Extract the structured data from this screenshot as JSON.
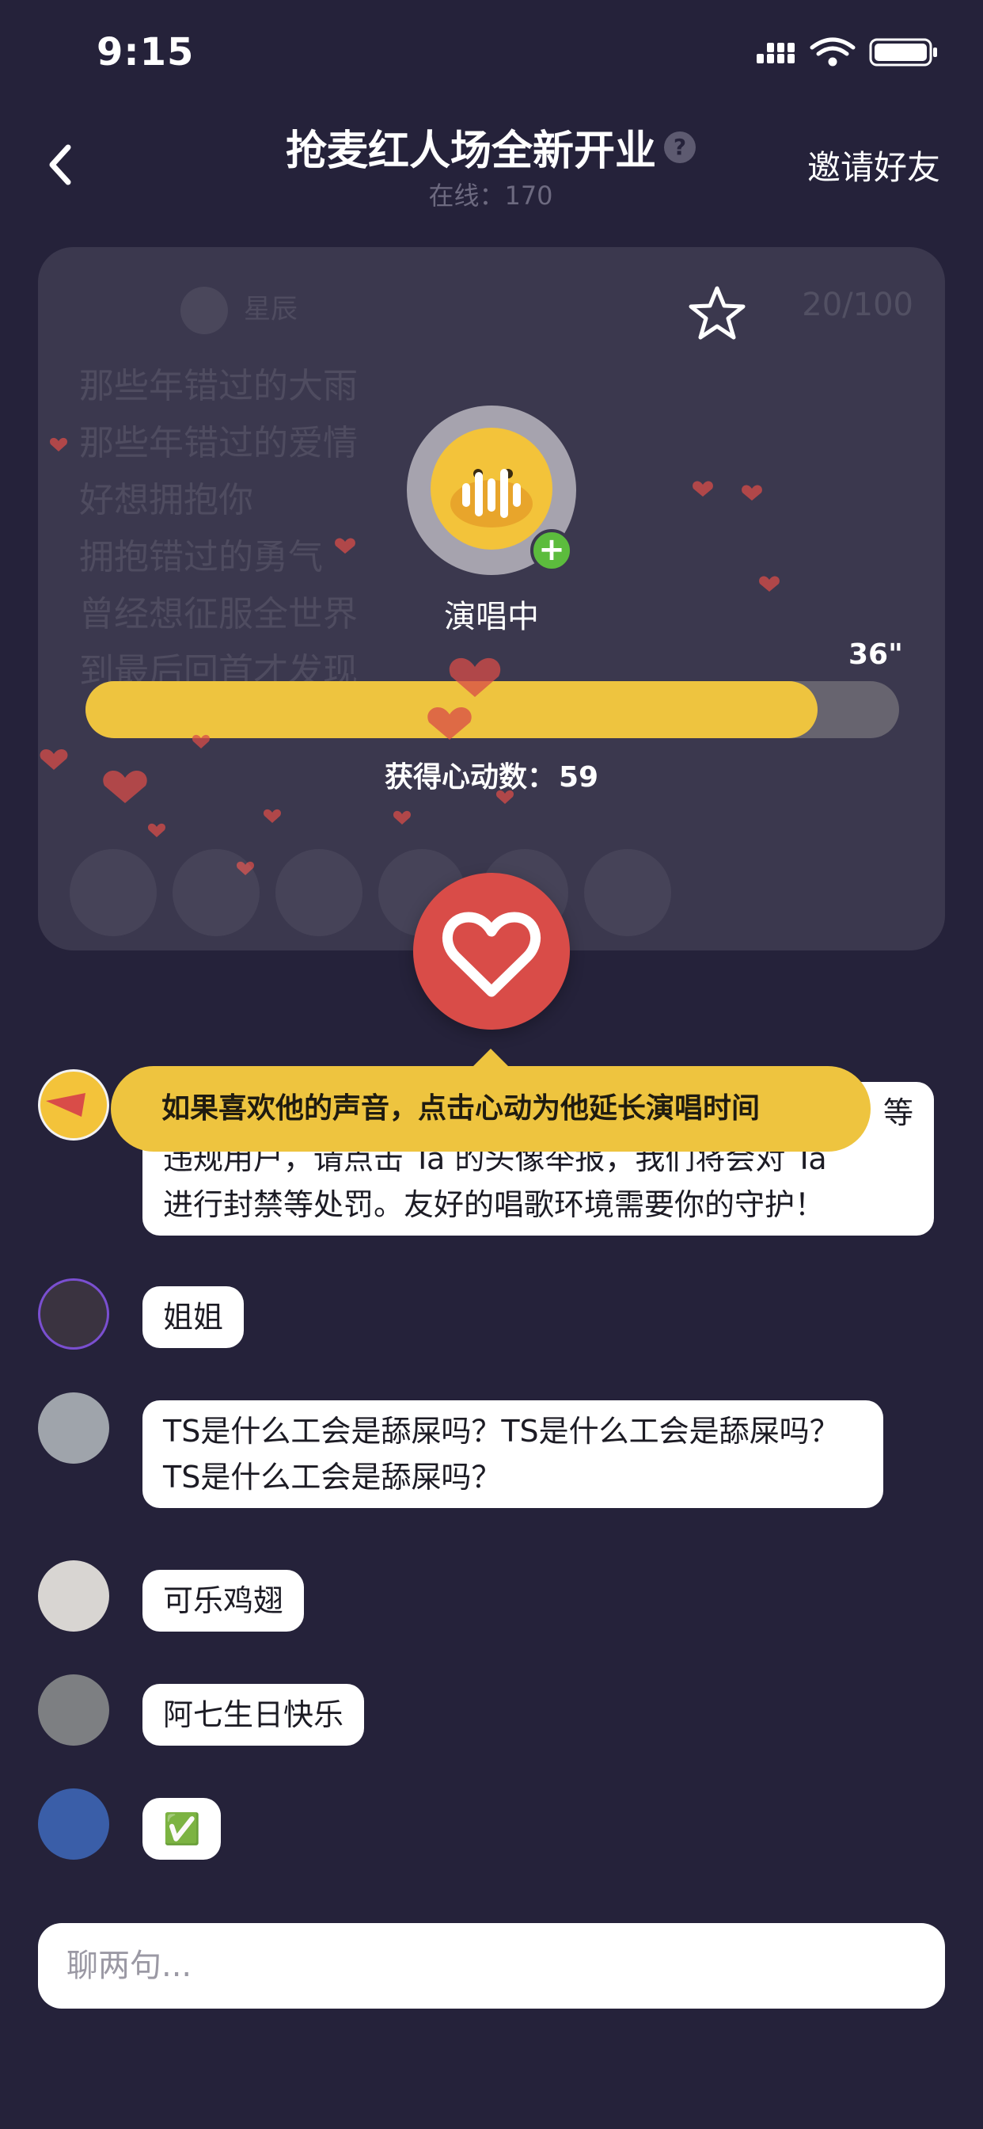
{
  "status_bar": {
    "time": "9:15"
  },
  "header": {
    "title": "抢麦红人场全新开业",
    "help_glyph": "?",
    "online_label": "在线：170",
    "invite_label": "邀请好友"
  },
  "stage": {
    "ghost_singer": "星辰",
    "counter": "20/100",
    "lyrics": [
      "那些年错过的大雨",
      "那些年错过的爱情",
      "好想拥抱你",
      "拥抱错过的勇气",
      "曾经想征服全世界",
      "到最后回首才发现"
    ],
    "singer_status": "演唱中",
    "remaining_time": "36\"",
    "progress_fraction": 0.9,
    "likes_label": "获得心动数：",
    "likes_count": "59",
    "plus_glyph": "+"
  },
  "tooltip": {
    "text": "如果喜欢他的声音，点击心动为他延长演唱时间"
  },
  "messages": [
    {
      "bubble_lines": [
        "等",
        "违规用户，请点击 Ta 的头像举报，我们将会对 Ta",
        "进行封禁等处罚。友好的唱歌环境需要你的守护！"
      ],
      "avatar_color": "#f2f2f2"
    },
    {
      "text": "姐姐",
      "avatar_color": "#3a3340"
    },
    {
      "text": "TS是什么工会是舔屎吗？TS是什么工会是舔屎吗？TS是什么工会是舔屎吗？",
      "avatar_color": "#9fa4ab"
    },
    {
      "text": "可乐鸡翅",
      "avatar_color": "#d8d5d2"
    },
    {
      "text": "阿七生日快乐",
      "avatar_color": "#7d7f82"
    },
    {
      "text": "✅",
      "avatar_color": "#3a5ea8"
    }
  ],
  "input": {
    "placeholder": "聊两句..."
  },
  "colors": {
    "background": "#25223a",
    "card": "#3b384e",
    "accent_yellow": "#eec43f",
    "heart_red": "#d94c48",
    "add_green": "#5cbc3d"
  }
}
